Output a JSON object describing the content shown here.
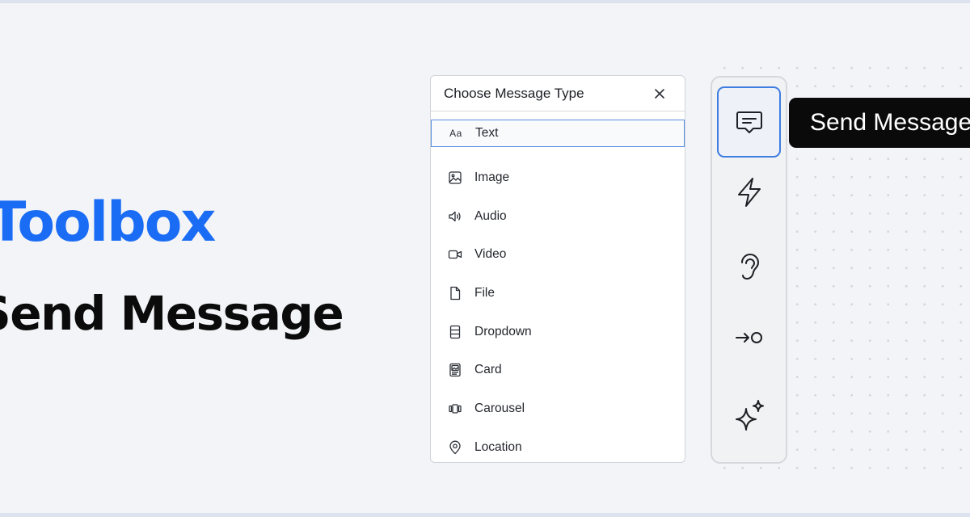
{
  "hero": {
    "title": "Toolbox",
    "subtitle": "Send Message"
  },
  "panel": {
    "title": "Choose Message Type",
    "close_icon": "close-icon",
    "items": [
      {
        "label": "Text",
        "icon": "Aa",
        "selected": true
      },
      {
        "label": "Image",
        "icon": "image-icon"
      },
      {
        "label": "Audio",
        "icon": "speaker-icon"
      },
      {
        "label": "Video",
        "icon": "video-camera-icon"
      },
      {
        "label": "File",
        "icon": "file-icon"
      },
      {
        "label": "Dropdown",
        "icon": "dropdown-icon"
      },
      {
        "label": "Card",
        "icon": "card-icon"
      },
      {
        "label": "Carousel",
        "icon": "carousel-icon"
      },
      {
        "label": "Location",
        "icon": "location-pin-icon"
      }
    ]
  },
  "toolbar": {
    "tools": [
      {
        "name": "send-message",
        "icon": "message-icon",
        "active": true
      },
      {
        "name": "action",
        "icon": "lightning-icon"
      },
      {
        "name": "listen",
        "icon": "ear-icon"
      },
      {
        "name": "go-to",
        "icon": "arrow-to-circle-icon"
      },
      {
        "name": "ai",
        "icon": "sparkles-icon"
      }
    ]
  },
  "tooltip": {
    "text": "Send Message"
  },
  "colors": {
    "accent": "#1a6cf5",
    "selected_border": "#5b8fe0",
    "active_tool_border": "#3f7de0",
    "background": "#f3f4f7",
    "tooltip_bg": "#0a0a0a"
  }
}
